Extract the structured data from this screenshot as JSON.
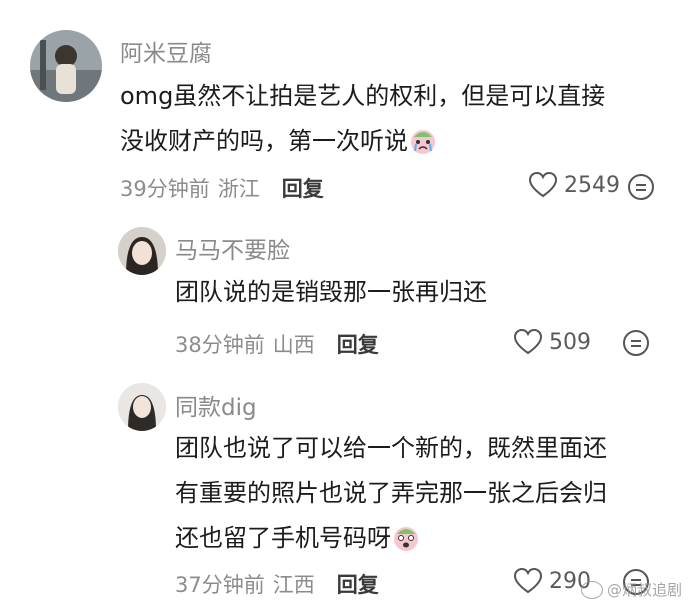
{
  "comments": [
    {
      "username": "阿米豆腐",
      "lines": [
        "omg虽然不让拍是艺人的权利，但是可以直接",
        "没收财产的吗，第一次听说"
      ],
      "emoji": "crying-face-emoji",
      "time": "39分钟前",
      "location": "浙江",
      "reply": "回复",
      "likes": "2549"
    },
    {
      "username": "马马不要脸",
      "lines": [
        "团队说的是销毁那一张再归还"
      ],
      "time": "38分钟前",
      "location": "山西",
      "reply": "回复",
      "likes": "509"
    },
    {
      "username": "同款dig",
      "lines": [
        "团队也说了可以给一个新的，既然里面还",
        "有重要的照片也说了弄完那一张之后会归",
        "还也留了手机号码呀"
      ],
      "emoji": "scared-face-emoji",
      "time": "37分钟前",
      "location": "江西",
      "reply": "回复",
      "likes": "290"
    }
  ],
  "watermark": "@炳叔追剧",
  "colors": {
    "secondary_text": "#8a8a8a",
    "primary_text": "#1c1c1c",
    "emoji_pink": "#f2a7b5"
  }
}
